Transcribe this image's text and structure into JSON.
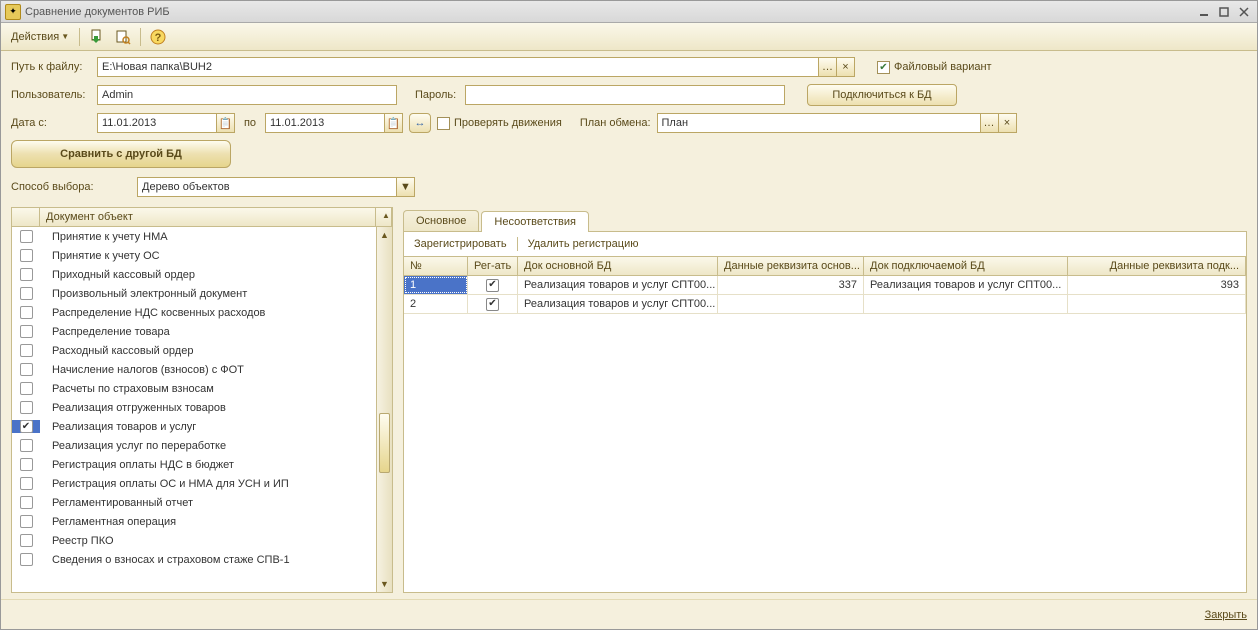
{
  "window": {
    "title": "Сравнение документов РИБ"
  },
  "toolbar": {
    "actions_label": "Действия"
  },
  "form": {
    "path_label": "Путь к файлу:",
    "path_value": "E:\\Новая папка\\BUH2",
    "file_variant_label": "Файловый вариант",
    "file_variant_checked": true,
    "user_label": "Пользователь:",
    "user_value": "Admin",
    "password_label": "Пароль:",
    "password_value": "",
    "connect_label": "Подключиться к БД",
    "date_from_label": "Дата с:",
    "date_from_value": "11.01.2013",
    "date_to_label": "по",
    "date_to_value": "11.01.2013",
    "check_movements_label": "Проверять движения",
    "exchange_plan_label": "План обмена:",
    "exchange_plan_value": "План",
    "compare_button_label": "Сравнить с другой БД",
    "selection_mode_label": "Способ выбора:",
    "selection_mode_value": "Дерево объектов"
  },
  "tree": {
    "header": "Документ объект",
    "items": [
      {
        "label": "Принятие к учету НМА",
        "checked": false
      },
      {
        "label": "Принятие к учету ОС",
        "checked": false
      },
      {
        "label": "Приходный кассовый ордер",
        "checked": false
      },
      {
        "label": "Произвольный электронный документ",
        "checked": false
      },
      {
        "label": "Распределение НДС косвенных расходов",
        "checked": false
      },
      {
        "label": "Распределение товара",
        "checked": false
      },
      {
        "label": "Расходный кассовый ордер",
        "checked": false
      },
      {
        "label": "Начисление налогов (взносов) с ФОТ",
        "checked": false
      },
      {
        "label": "Расчеты по страховым взносам",
        "checked": false
      },
      {
        "label": "Реализация отгруженных товаров",
        "checked": false
      },
      {
        "label": "Реализация товаров и услуг",
        "checked": true,
        "selected": true
      },
      {
        "label": "Реализация услуг по переработке",
        "checked": false
      },
      {
        "label": "Регистрация оплаты НДС в бюджет",
        "checked": false
      },
      {
        "label": "Регистрация оплаты ОС и НМА для УСН и ИП",
        "checked": false
      },
      {
        "label": "Регламентированный отчет",
        "checked": false
      },
      {
        "label": "Регламентная операция",
        "checked": false
      },
      {
        "label": "Реестр ПКО",
        "checked": false
      },
      {
        "label": "Сведения о взносах и страховом стаже СПВ-1",
        "checked": false
      }
    ]
  },
  "tabs": {
    "items": [
      {
        "label": "Основное",
        "active": false
      },
      {
        "label": "Несоответствия",
        "active": true
      }
    ],
    "actions": {
      "register": "Зарегистрировать",
      "delete": "Удалить регистрацию"
    },
    "columns": {
      "num": "№",
      "reg": "Рег-ать",
      "doc_main": "Док основной БД",
      "val_main": "Данные реквизита основ...",
      "doc_conn": "Док подключаемой БД",
      "val_conn": "Данные реквизита подк..."
    },
    "rows": [
      {
        "num": "1",
        "reg": true,
        "doc_main": "Реализация товаров и услуг СПТ00...",
        "val_main": "337",
        "doc_conn": "Реализация товаров и услуг СПТ00...",
        "val_conn": "393",
        "selected": true
      },
      {
        "num": "2",
        "reg": true,
        "doc_main": "Реализация товаров и услуг СПТ00...",
        "val_main": "",
        "doc_conn": "",
        "val_conn": "",
        "selected": false
      }
    ]
  },
  "footer": {
    "close_label": "Закрыть"
  }
}
